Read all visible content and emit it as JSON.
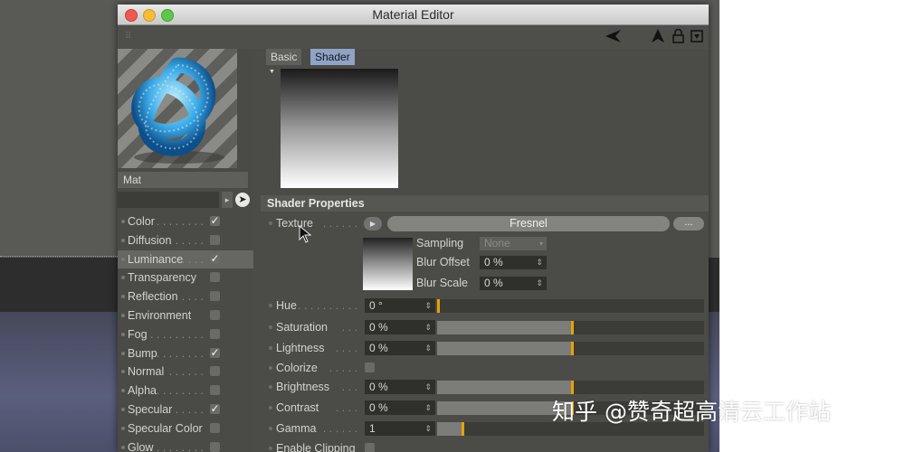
{
  "window": {
    "title": "Material Editor"
  },
  "material": {
    "name": "Mat"
  },
  "tabs": [
    {
      "label": "Basic",
      "active": false
    },
    {
      "label": "Shader",
      "active": true
    }
  ],
  "channels": [
    {
      "label": "Color",
      "leader": ". . . . . . . .",
      "checked": true
    },
    {
      "label": "Diffusion",
      "leader": ". . . . . .",
      "checked": false
    },
    {
      "label": "Luminance",
      "leader": ". . . .",
      "checked": true,
      "active": true
    },
    {
      "label": "Transparency",
      "leader": "",
      "checked": false
    },
    {
      "label": "Reflection",
      "leader": ". . . .",
      "checked": false
    },
    {
      "label": "Environment",
      "leader": "",
      "checked": false
    },
    {
      "label": "Fog",
      "leader": ". . . . . . . . . .",
      "checked": false
    },
    {
      "label": "Bump",
      "leader": ". . . . . . . .",
      "checked": true
    },
    {
      "label": "Normal",
      "leader": ". . . . . .",
      "checked": false
    },
    {
      "label": "Alpha",
      "leader": ". . . . . . . .",
      "checked": false
    },
    {
      "label": "Specular",
      "leader": ". . . . .",
      "checked": true
    },
    {
      "label": "Specular Color",
      "leader": "",
      "checked": false
    },
    {
      "label": "Glow",
      "leader": ". . . . . . . . . .",
      "checked": false
    }
  ],
  "shader_properties": {
    "header": "Shader Properties",
    "texture": {
      "label": "Texture",
      "leader": ". . . . . .",
      "value": "Fresnel",
      "more": "..."
    },
    "sampling": {
      "label": "Sampling",
      "value": "None"
    },
    "blur_offset": {
      "label": "Blur Offset",
      "value": "0 %"
    },
    "blur_scale": {
      "label": "Blur Scale",
      "value": "0 %"
    },
    "rows": [
      {
        "label": "Hue",
        "leader": ". . . . . . . . . .",
        "value": "0 °",
        "fill": 0.0,
        "knob": 0.0
      },
      {
        "label": "Saturation",
        "leader": ". . .",
        "value": "0 %",
        "fill": 0.5,
        "knob": 0.5
      },
      {
        "label": "Lightness",
        "leader": ". . . .",
        "value": "0 %",
        "fill": 0.5,
        "knob": 0.5
      },
      {
        "label": "Colorize",
        "leader": ". . . . .",
        "type": "checkbox",
        "checked": false
      },
      {
        "label": "Brightness",
        "leader": ". . .",
        "value": "0 %",
        "fill": 0.5,
        "knob": 0.5
      },
      {
        "label": "Contrast",
        "leader": ". . . .",
        "value": "0 %",
        "fill": 0.5,
        "knob": 0.5
      },
      {
        "label": "Gamma",
        "leader": ". . . . . .",
        "value": "1",
        "fill": 0.09,
        "knob": 0.09
      },
      {
        "label": "Enable Clipping",
        "leader": "",
        "type": "checkbox",
        "checked": false
      }
    ]
  },
  "watermark": "知乎 @赞奇超高清云工作站",
  "colors": {
    "slider_knob": "#e8a300",
    "active_tab": "#8fa4c4",
    "active_channel": "#666662"
  }
}
